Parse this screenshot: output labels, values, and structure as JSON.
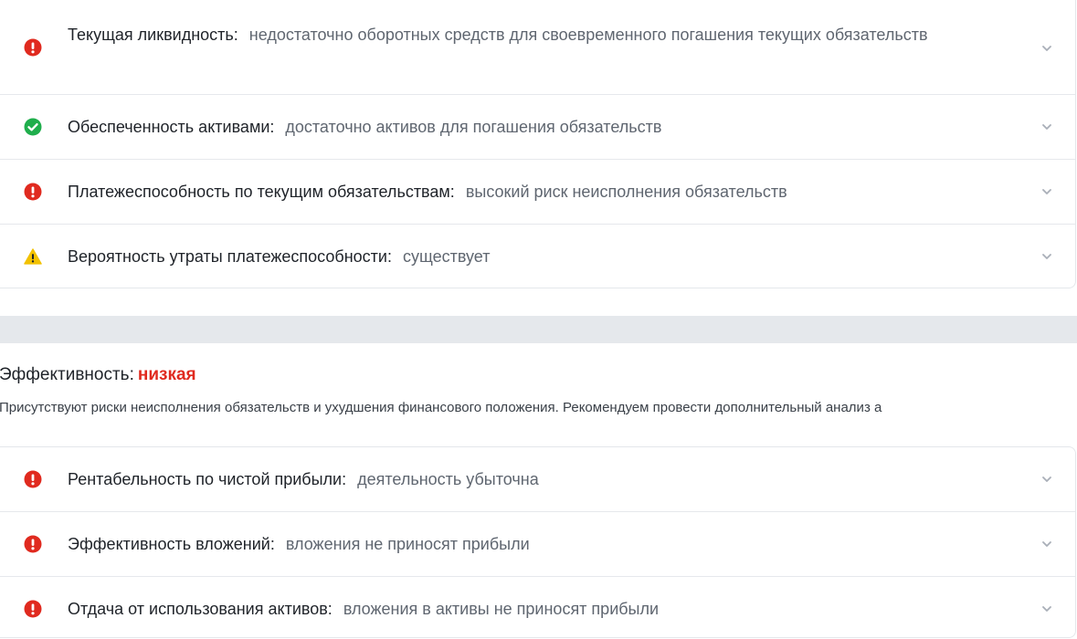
{
  "colors": {
    "danger": "#e02a1f",
    "success": "#1fae4c",
    "warning": "#f2c100",
    "value_text": "#5f6670",
    "divider": "#e6e8ec"
  },
  "solvency": {
    "rows": [
      {
        "status": "danger",
        "icon": "exclamation-circle-icon",
        "label": "Текущая ликвидность:",
        "value": "недостаточно оборотных средств для своевременного погашения текущих обязательств"
      },
      {
        "status": "success",
        "icon": "check-circle-icon",
        "label": "Обеспеченность активами:",
        "value": "достаточно активов для погашения обязательств"
      },
      {
        "status": "danger",
        "icon": "exclamation-circle-icon",
        "label": "Платежеспособность по текущим обязательствам:",
        "value": "высокий риск неисполнения обязательств"
      },
      {
        "status": "warning",
        "icon": "warning-triangle-icon",
        "label": "Вероятность утраты платежеспособности:",
        "value": "существует"
      }
    ]
  },
  "efficiency": {
    "title": "Эффективность:",
    "level": "низкая",
    "description": "Присутствуют риски неисполнения обязательств и ухудшения финансового положения. Рекомендуем провести дополнительный анализ а",
    "rows": [
      {
        "status": "danger",
        "icon": "exclamation-circle-icon",
        "label": "Рентабельность по чистой прибыли:",
        "value": "деятельность убыточна"
      },
      {
        "status": "danger",
        "icon": "exclamation-circle-icon",
        "label": "Эффективность вложений:",
        "value": "вложения не приносят прибыли"
      },
      {
        "status": "danger",
        "icon": "exclamation-circle-icon",
        "label": "Отдача от использования активов:",
        "value": "вложения в активы не приносят прибыли"
      }
    ]
  }
}
